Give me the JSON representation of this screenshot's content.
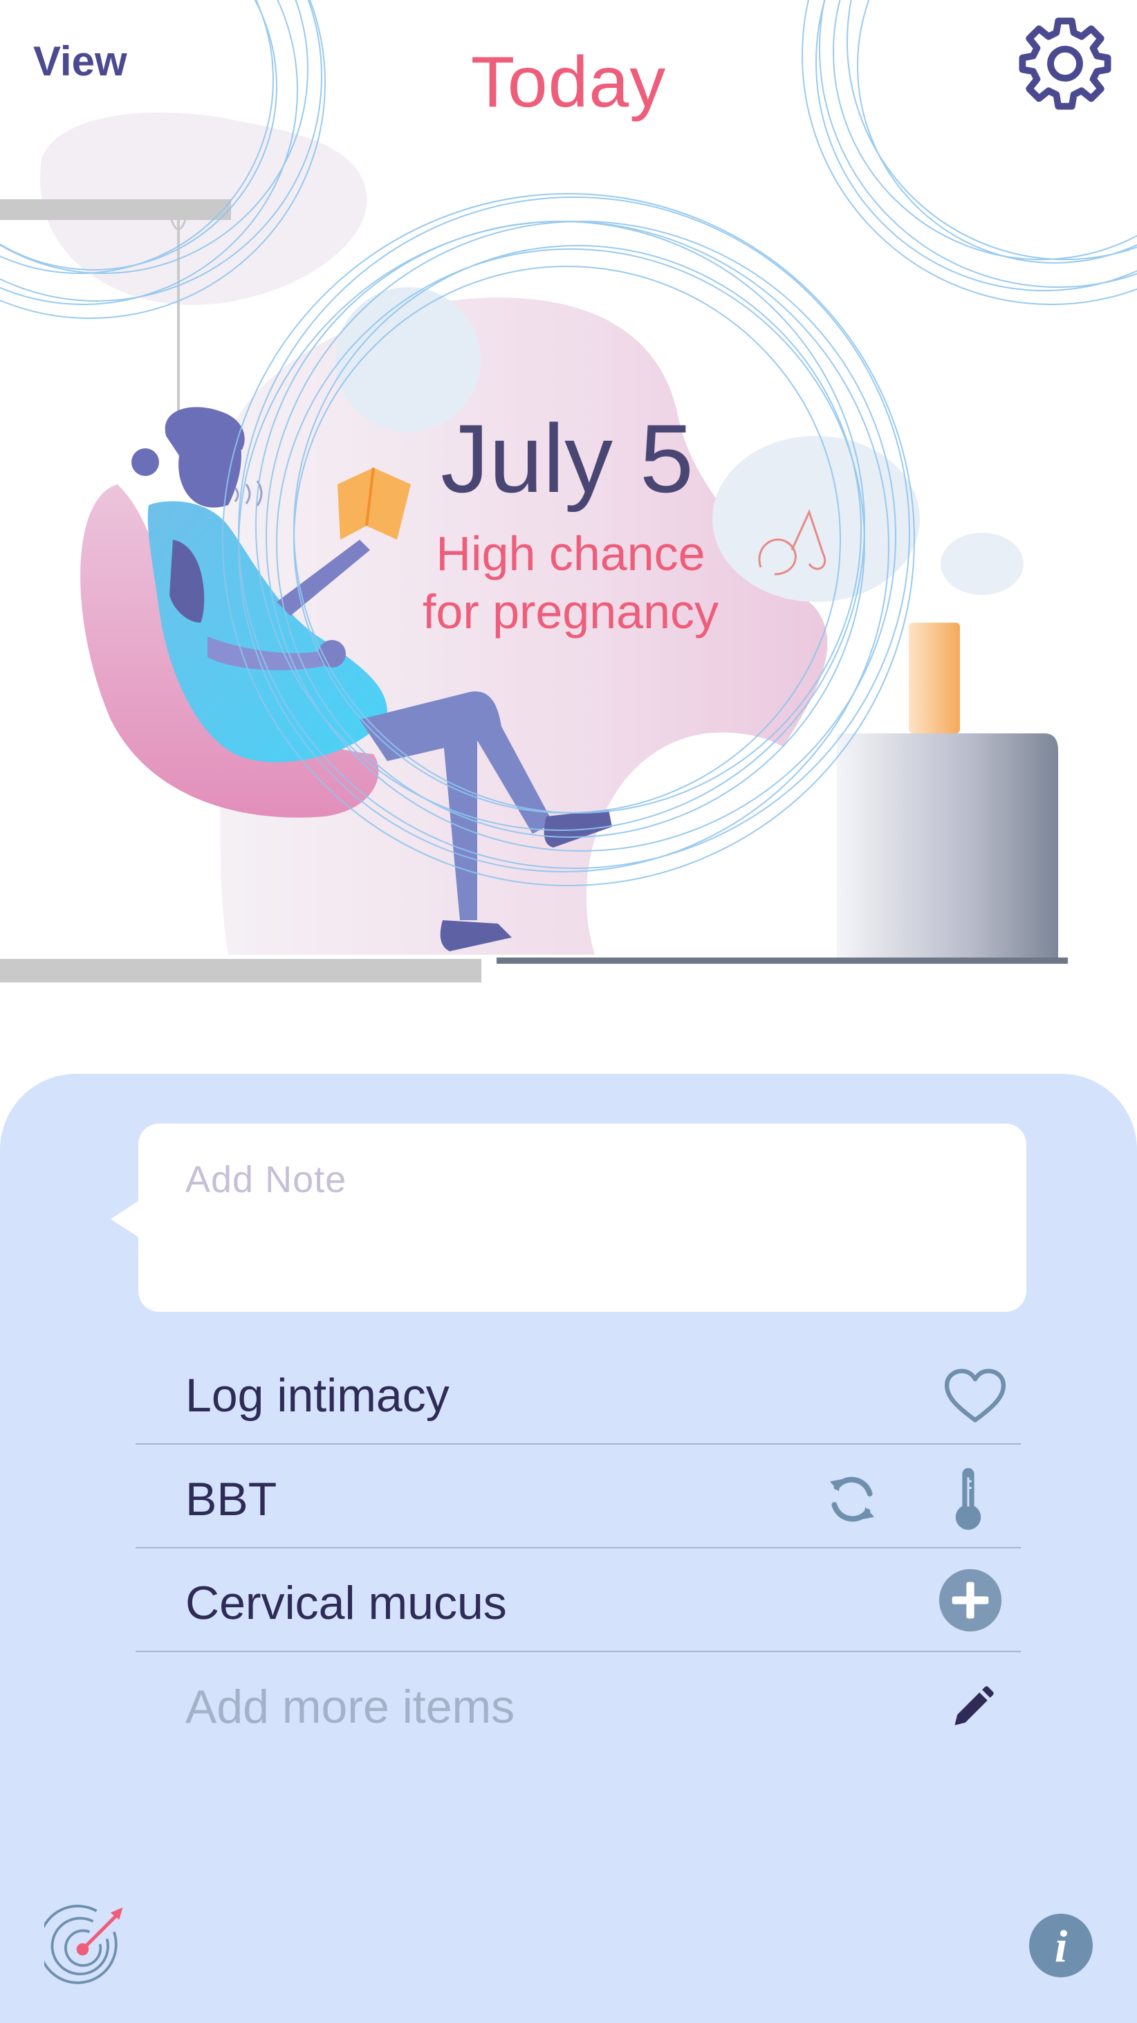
{
  "header": {
    "view_label": "View",
    "title": "Today",
    "settings_icon": "gear-icon"
  },
  "hero": {
    "date": "July 5",
    "chance_line1": "High chance",
    "chance_line2": "for pregnancy"
  },
  "note": {
    "placeholder": "Add Note",
    "value": ""
  },
  "log_items": [
    {
      "label": "Log intimacy",
      "icons": [
        "heart-icon"
      ]
    },
    {
      "label": "BBT",
      "icons": [
        "sync-icon",
        "thermometer-icon"
      ]
    },
    {
      "label": "Cervical mucus",
      "icons": [
        "plus-circle-icon"
      ]
    },
    {
      "label": "Add more items",
      "icons": [
        "pencil-icon"
      ]
    }
  ],
  "footer": {
    "left_icon": "target-icon",
    "right_icon": "info-icon",
    "info_glyph": "i"
  },
  "colors": {
    "accent_pink": "#ee5d7a",
    "brand_indigo": "#4b4a91",
    "panel_bg": "#d4e3fb",
    "icon_slate": "#6f8fae"
  }
}
